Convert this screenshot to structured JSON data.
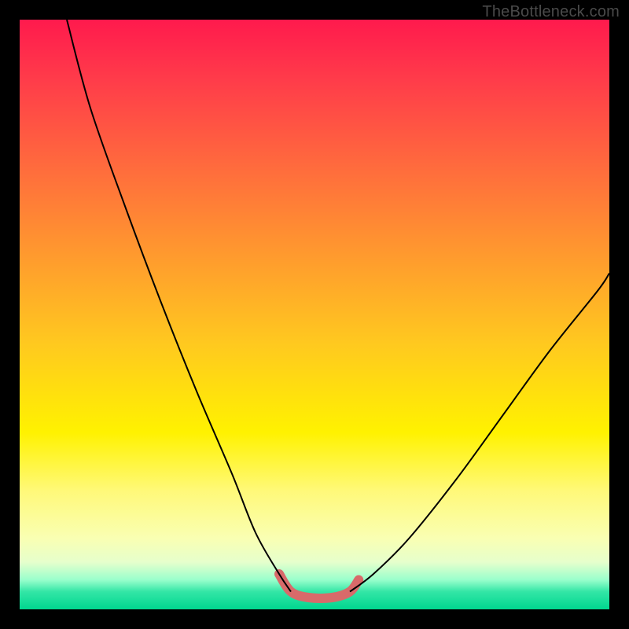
{
  "watermark": "TheBottleneck.com",
  "chart_data": {
    "type": "line",
    "title": "",
    "xlabel": "",
    "ylabel": "",
    "xlim": [
      0,
      100
    ],
    "ylim": [
      0,
      100
    ],
    "grid": false,
    "legend": false,
    "description": "V-shaped bottleneck curve over a vertical rainbow gradient (red at top through yellow to green at bottom). Two thin black curves descend from the top edges to a flat minimum near the bottom-center; a short salmon/pink highlight segment marks the flat minimum region.",
    "series": [
      {
        "name": "left-curve",
        "color": "#000000",
        "width": 2,
        "x": [
          8,
          12,
          18,
          24,
          30,
          36,
          40,
          44,
          46
        ],
        "y": [
          100,
          85,
          68,
          52,
          37,
          23,
          13,
          6,
          3
        ]
      },
      {
        "name": "right-curve",
        "color": "#000000",
        "width": 2,
        "x": [
          56,
          60,
          66,
          74,
          82,
          90,
          98,
          100
        ],
        "y": [
          3,
          6,
          12,
          22,
          33,
          44,
          54,
          57
        ]
      },
      {
        "name": "minimum-highlight",
        "color": "#d86a6a",
        "width": 12,
        "linecap": "round",
        "x": [
          44,
          46,
          49,
          53,
          56,
          57.5
        ],
        "y": [
          6,
          3,
          2,
          2,
          3,
          5
        ]
      }
    ],
    "gradient_stops": [
      {
        "pos": 0,
        "color": "#ff1a4d"
      },
      {
        "pos": 10,
        "color": "#ff3b4a"
      },
      {
        "pos": 25,
        "color": "#ff6b3d"
      },
      {
        "pos": 40,
        "color": "#ff9a2e"
      },
      {
        "pos": 55,
        "color": "#ffc91f"
      },
      {
        "pos": 70,
        "color": "#fff200"
      },
      {
        "pos": 80,
        "color": "#fff97a"
      },
      {
        "pos": 88,
        "color": "#f9ffb3"
      },
      {
        "pos": 92,
        "color": "#e6ffcc"
      },
      {
        "pos": 95,
        "color": "#99ffcc"
      },
      {
        "pos": 97,
        "color": "#33e6a6"
      },
      {
        "pos": 100,
        "color": "#00d68f"
      }
    ]
  }
}
